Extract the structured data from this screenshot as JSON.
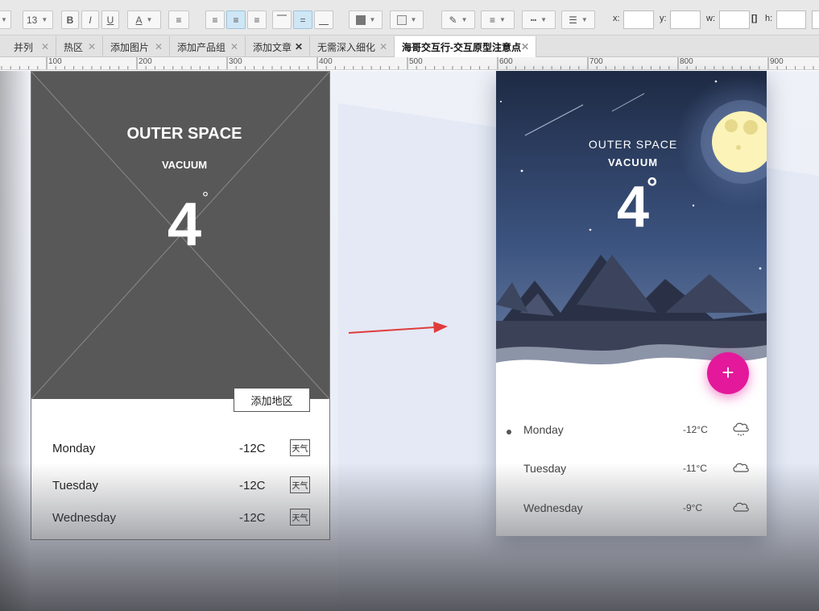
{
  "toolbar": {
    "font_size": "13",
    "bold": "B",
    "italic": "I",
    "underline": "U",
    "font_color": "A",
    "x_label": "x:",
    "y_label": "y:",
    "w_label": "w:",
    "h_label": "h:"
  },
  "tabs": [
    {
      "label": "并列"
    },
    {
      "label": "热区"
    },
    {
      "label": "添加图片"
    },
    {
      "label": "添加产品组"
    },
    {
      "label": "添加文章"
    },
    {
      "label": "无需深入细化"
    },
    {
      "label": "海哥交互行-交互原型注意点"
    }
  ],
  "ruler": {
    "ticks": [
      "100",
      "200",
      "300",
      "400",
      "500",
      "600",
      "700",
      "800",
      "900"
    ]
  },
  "wireframe": {
    "title": "OUTER SPACE",
    "subtitle": "VACUUM",
    "temperature": "4",
    "degree": "°",
    "hotspot_label": "添加地区",
    "rows": [
      {
        "day": "Monday",
        "temp": "-12C",
        "icon_label": "天气"
      },
      {
        "day": "Tuesday",
        "temp": "-12C",
        "icon_label": "天气"
      },
      {
        "day": "Wednesday",
        "temp": "-12C",
        "icon_label": "天气"
      }
    ]
  },
  "mockup": {
    "title": "OUTER SPACE",
    "subtitle": "VACUUM",
    "temperature": "4",
    "degree": "°",
    "fab_label": "+",
    "rows": [
      {
        "day": "Monday",
        "temp": "-12°C",
        "icon": "snow-cloud-icon"
      },
      {
        "day": "Tuesday",
        "temp": "-11°C",
        "icon": "cloud-icon"
      },
      {
        "day": "Wednesday",
        "temp": "-9°C",
        "icon": "cloud-icon"
      }
    ]
  },
  "colors": {
    "accent": "#e3189a",
    "arrow": "#e03c3c",
    "wire_fill": "#585858",
    "sky_top": "#1e2a44"
  }
}
